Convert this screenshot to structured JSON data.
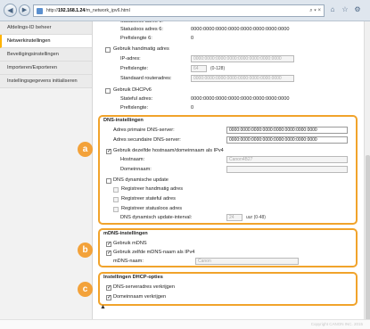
{
  "browser": {
    "url_prefix": "http://",
    "url_domain": "192.168.1.24",
    "url_path": "/m_network_ipv6.html",
    "addr_tools": "⌕ ▾ ×"
  },
  "sidebar": {
    "items": [
      {
        "label": "Afdelings-ID beheer"
      },
      {
        "label": "Netwerkinstellingen"
      },
      {
        "label": "Beveiligingsinstellingen"
      },
      {
        "label": "Importeren/Exporteren"
      },
      {
        "label": "Instellingsgegevens initialiseren"
      }
    ]
  },
  "ipv6_top": {
    "stateless_addr_label": "Statusloos adres 6:",
    "stateless_addr_value": "0000:0000:0000:0000:0000:0000:0000:0000",
    "prefix_label_a": "Prefixlengte 6:",
    "prefix_value_a": "0",
    "manual_addr_label": "Gebruik handmatig adres",
    "ip_label": "IP-adres:",
    "ip_value": "0000:0000:0000:0000:0000:0000:0000:0000",
    "prefix_label_b": "Prefixlengte:",
    "prefix_value_b": "64",
    "prefix_range": "(0-128)",
    "router_label": "Standaard routeradres:",
    "router_value": "0000:0000:0000:0000:0000:0000:0000:0000",
    "dhcp_label": "Gebruik DHCPv6",
    "stateful_label": "Stateful adres:",
    "stateful_value": "0000:0000:0000:0000:0000:0000:0000:0000",
    "prefix_label_c": "Prefixlengte:",
    "prefix_value_c": "0"
  },
  "dns": {
    "title": "DNS-instellingen",
    "primary_label": "Adres primaire DNS-server:",
    "primary_value": "0000:0000:0000:0000:0000:0000:0000:0000",
    "secondary_label": "Adres secundaire DNS-server:",
    "secondary_value": "0000:0000:0000:0000:0000:0000:0000:0000",
    "same_host_label": "Gebruik dezelfde hostnaam/domeinnaam als IPv4",
    "hostname_label": "Hostnaam:",
    "hostname_value": "Canon4B27",
    "domain_label": "Domeinnaam:",
    "domain_value": "",
    "dyn_update_label": "DNS dynamische update",
    "reg_manual_label": "Registreer handmatig adres",
    "reg_stateful_label": "Registreer stateful adres",
    "reg_stateless_label": "Registreer statusloos adres",
    "interval_label": "DNS dynamisch update-interval:",
    "interval_value": "24",
    "interval_unit": "uur (0-48)",
    "badge": "a"
  },
  "mdns": {
    "title": "mDNS-instellingen",
    "use_label": "Gebruik mDNS",
    "same_name_label": "Gebruik zelfde mDNS-naam als IPv4",
    "name_label": "mDNS-naam:",
    "name_value": "Canon",
    "badge": "b"
  },
  "dhcp": {
    "title": "Instellingen DHCP-opties",
    "dns_server_label": "DNS-serveradres verkrijgen",
    "domain_name_label": "Domeinnaam verkrijgen",
    "badge": "c"
  },
  "footer": {
    "to_top": "▲",
    "copyright": "Copyright CANON INC. 2015"
  },
  "colors": {
    "accent": "#f3a23a",
    "callout_border": "#f1a32b"
  }
}
